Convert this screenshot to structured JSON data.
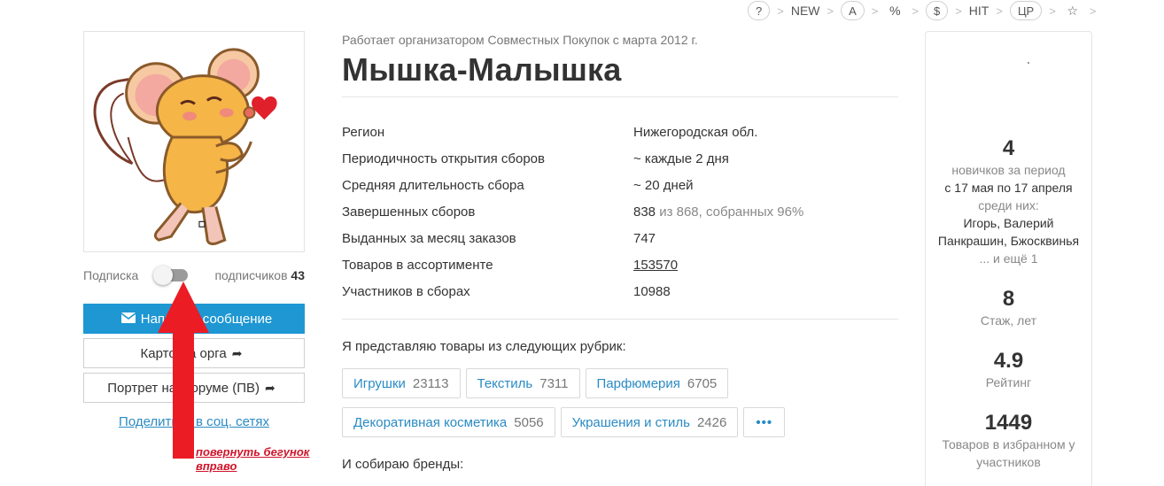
{
  "topnav": {
    "items": [
      {
        "label": "?",
        "circle": true
      },
      {
        "label": "NEW",
        "circle": false
      },
      {
        "label": "A",
        "circle": true
      },
      {
        "label": "%",
        "circle": false
      },
      {
        "label": "$",
        "circle": true
      },
      {
        "label": "HIT",
        "circle": false
      },
      {
        "label": "ЦР",
        "circle": true
      },
      {
        "label": "☆",
        "circle": false
      }
    ],
    "separator": ">"
  },
  "subscription": {
    "label": "Подписка",
    "enabled": false,
    "count_label": "подписчиков",
    "count": "43"
  },
  "buttons": {
    "message": "Написать сообщение",
    "org_card": "Карточка орга",
    "forum_portrait": "Портрет на форуме (ПВ)",
    "share": "Поделиться в соц. сетях"
  },
  "annotation": {
    "line1": "повернуть бегунок",
    "line2": "вправо"
  },
  "profile": {
    "since": "Работает организатором Совместных Покупок с марта 2012 г.",
    "name": "Мышка-Малышка"
  },
  "stats": [
    {
      "key": "Регион",
      "value": "Нижегородская обл.",
      "extra": "",
      "link": false
    },
    {
      "key": "Периодичность открытия сборов",
      "value": "~ каждые 2 дня",
      "extra": "",
      "link": false
    },
    {
      "key": "Средняя длительность сбора",
      "value": "~ 20 дней",
      "extra": "",
      "link": false
    },
    {
      "key": "Завершенных сборов",
      "value": "838",
      "extra": " из 868, собранных 96%",
      "link": false
    },
    {
      "key": "Выданных за месяц заказов",
      "value": "747",
      "extra": "",
      "link": false
    },
    {
      "key": "Товаров в ассортименте",
      "value": "153570",
      "extra": "",
      "link": true
    },
    {
      "key": "Участников в сборах",
      "value": "10988",
      "extra": "",
      "link": false
    }
  ],
  "rubrics": {
    "title": "Я представляю товары из следующих рубрик:",
    "items": [
      {
        "name": "Игрушки",
        "count": "23113"
      },
      {
        "name": "Текстиль",
        "count": "7311"
      },
      {
        "name": "Парфюмерия",
        "count": "6705"
      },
      {
        "name": "Декоративная косметика",
        "count": "5056"
      },
      {
        "name": "Украшения и стиль",
        "count": "2426"
      }
    ],
    "more": "•••"
  },
  "brands_title": "И собираю бренды:",
  "right_panel": {
    "newcomers": {
      "value": "4",
      "label": "новичков за период",
      "period": "с 17 мая по 17 апреля",
      "among": "среди них:",
      "names1": "Игорь, Валерий",
      "names2": "Панкрашин, Бжосквинья",
      "more": "... и ещё 1"
    },
    "experience": {
      "value": "8",
      "label": "Стаж, лет"
    },
    "rating": {
      "value": "4.9",
      "label": "Рейтинг"
    },
    "favorites": {
      "value": "1449",
      "label1": "Товаров в избранном у",
      "label2": "участников"
    }
  },
  "colors": {
    "primary": "#1e97d3",
    "link": "#2a8bc4",
    "annotation": "#d0142b"
  }
}
